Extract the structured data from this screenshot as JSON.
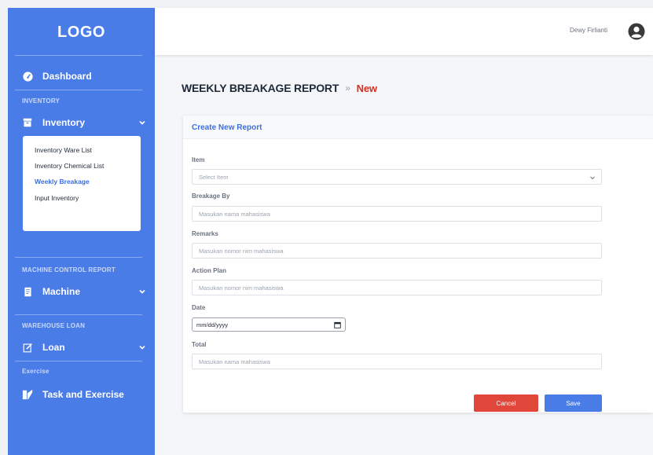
{
  "sidebar": {
    "logo": "LOGO",
    "dashboard": "Dashboard",
    "section_inventory": "INVENTORY",
    "inventory": "Inventory",
    "submenu": [
      "Inventory Ware List",
      "Inventory Chemical List",
      "Weekly Breakage",
      "Input Inventory"
    ],
    "active_submenu": "Weekly Breakage",
    "section_machine": "MACHINE CONTROL REPORT",
    "machine": "Machine",
    "section_warehouse": "WAREHOUSE LOAN",
    "loan": "Loan",
    "section_exercise": "Exercise",
    "task": "Task and Exercise"
  },
  "header": {
    "user_name": "Dewy Firlianti"
  },
  "page": {
    "title": "WEEKLY BREAKAGE REPORT",
    "separator": "»",
    "status": "New"
  },
  "form": {
    "title": "Create New Report",
    "item_label": "Item",
    "item_placeholder": "Select Item",
    "breakage_label": "Breakage By",
    "breakage_placeholder": "Masukan nama mahasiswa",
    "remarks_label": "Remarks",
    "remarks_placeholder": "Masukan nomor nim mahasiswa",
    "action_label": "Action Plan",
    "action_placeholder": "Masukan nomor nim mahasiswa",
    "date_label": "Date",
    "date_placeholder": "mm/dd/yyyy",
    "total_label": "Total",
    "total_placeholder": "Masukan nama mahasiswa",
    "cancel": "Cancel",
    "save": "Save"
  },
  "colors": {
    "sidebar": "#4a7ce8",
    "accent": "#3b6fe0",
    "new_status": "#d92d20",
    "cancel": "#e0463a",
    "save": "#4a7ce8"
  },
  "icons": {
    "dashboard": "speedometer-icon",
    "inventory": "archive-box-icon",
    "machine": "document-icon",
    "loan": "edit-icon",
    "task": "task-icon",
    "avatar": "user-circle-icon"
  }
}
